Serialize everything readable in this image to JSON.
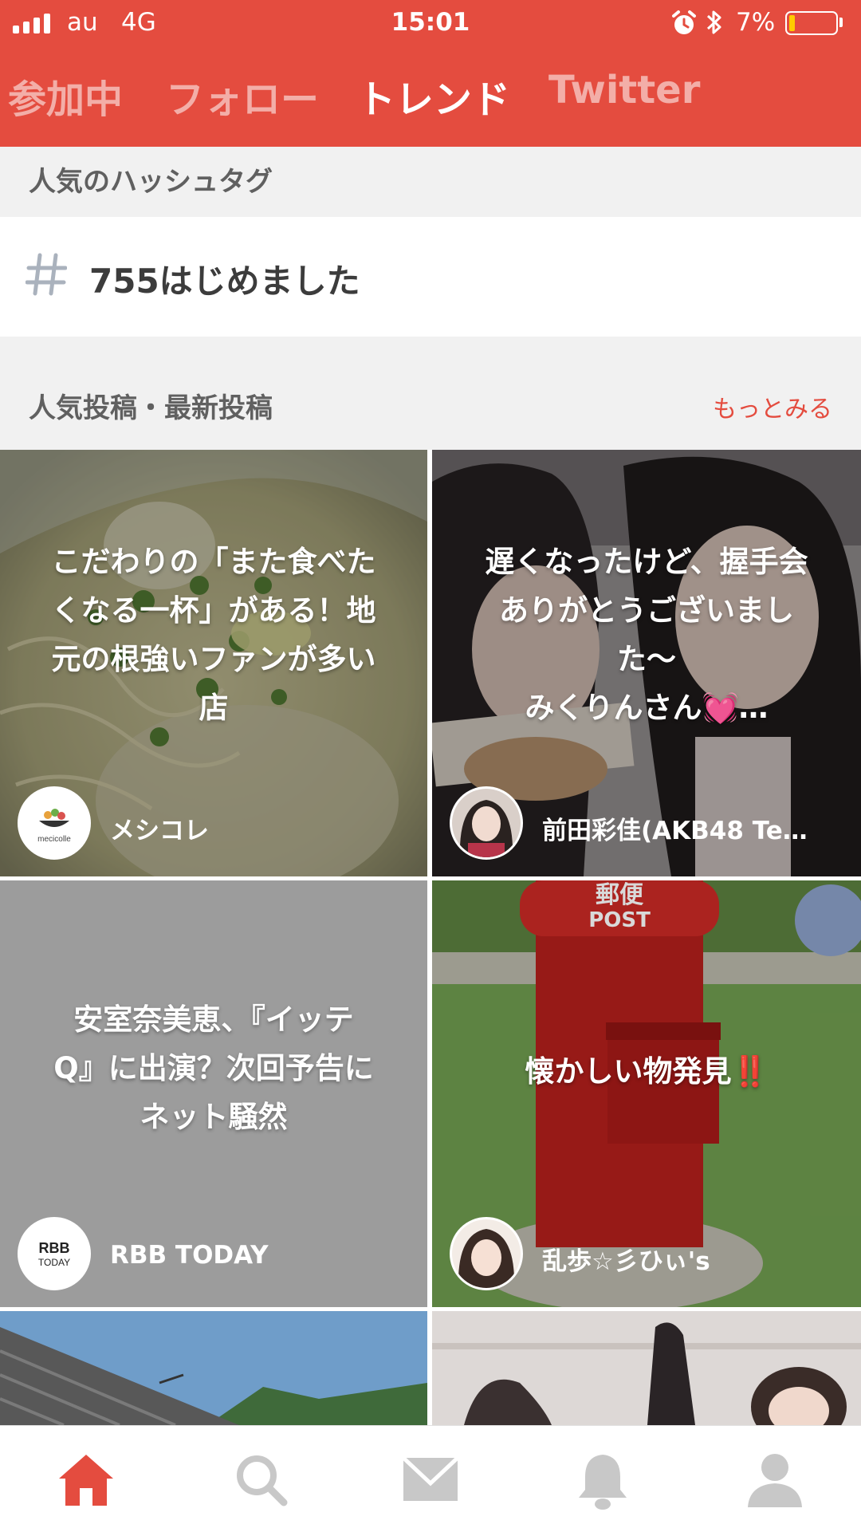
{
  "status_bar": {
    "carrier": "au",
    "network": "4G",
    "time": "15:01",
    "battery_percent": "7%",
    "battery_level": 0.07
  },
  "tabs": [
    {
      "label": "参加中",
      "active": false
    },
    {
      "label": "フォロー",
      "active": false
    },
    {
      "label": "トレンド",
      "active": true
    },
    {
      "label": "Twitter",
      "active": false
    }
  ],
  "hashtags_section": {
    "title": "人気のハッシュタグ",
    "items": [
      {
        "symbol": "#",
        "text": "755はじめました"
      }
    ]
  },
  "posts_section": {
    "title": "人気投稿・最新投稿",
    "more_label": "もっとみる"
  },
  "posts": [
    {
      "title_lines": [
        "こだわりの「また食べた",
        "くなる一杯」がある！地",
        "元の根強いファンが多い",
        "店"
      ],
      "author": "メシコレ",
      "avatar_text": "mecicolle"
    },
    {
      "title_lines": [
        "遅くなったけど、握手会",
        "ありがとうございまし",
        "た〜",
        "みくりんさん💓…"
      ],
      "author": "前田彩佳(AKB48 Te…",
      "avatar_text": ""
    },
    {
      "title_lines": [
        "安室奈美恵、『イッテ",
        "Q』に出演？次回予告に",
        "ネット騒然"
      ],
      "author": "RBB TODAY",
      "avatar_text": "RBB TODAY"
    },
    {
      "title_lines": [
        "懐かしい物発見‼️"
      ],
      "author": "乱歩☆彡ひぃ's",
      "avatar_text": ""
    }
  ],
  "postbox_text": {
    "top": "郵便",
    "bottom": "POST"
  },
  "bottom_nav": [
    {
      "icon": "home-icon",
      "active": true
    },
    {
      "icon": "search-icon",
      "active": false
    },
    {
      "icon": "mail-icon",
      "active": false
    },
    {
      "icon": "bell-icon",
      "active": false
    },
    {
      "icon": "profile-icon",
      "active": false
    }
  ],
  "colors": {
    "brand": "#e44c3f",
    "inactive_icon": "#c8c8c8",
    "section_bg": "#f1f1f1"
  }
}
